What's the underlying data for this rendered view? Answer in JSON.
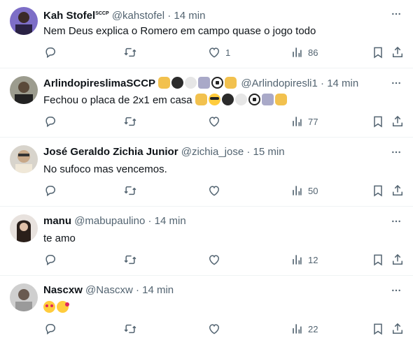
{
  "colors": {
    "muted": "#536471",
    "text": "#0f1419",
    "divider": "#eff3f4"
  },
  "tweets": [
    {
      "name": "Kah Stofel",
      "name_badge": "SCCP",
      "handle": "@kahstofel",
      "time": "14 min",
      "text": "Nem Deus explica o Romero em campo quase o jogo todo",
      "likes": "1",
      "views": "86"
    },
    {
      "name": "ArlindopireslimaSCCP",
      "name_emojis": [
        "fist-icon",
        "black-circle-icon",
        "white-circle-icon",
        "stadium-icon",
        "soccer-ball-icon",
        "fist-icon"
      ],
      "handle": "@Arlindopiresli1",
      "time": "14 min",
      "text": "Fechou o placa de 2x1 em casa",
      "text_emojis": [
        "fist-icon",
        "cool-face-icon",
        "black-circle-icon",
        "white-circle-icon",
        "soccer-ball-icon",
        "stadium-icon",
        "fist-icon"
      ],
      "views": "77"
    },
    {
      "name": "José Geraldo Zichia Junior",
      "handle": "@zichia_jose",
      "time": "15 min",
      "text": "No sufoco mas vencemos.",
      "views": "50"
    },
    {
      "name": "manu",
      "handle": "@mabupaulino",
      "time": "14 min",
      "text": "te amo",
      "views": "12"
    },
    {
      "name": "Nascxw",
      "handle": "@Nascxw",
      "time": "14 min",
      "text_emojis": [
        "heart-eyes-icon",
        "hugging-face-icon"
      ],
      "views": "22"
    }
  ],
  "sep": "·"
}
